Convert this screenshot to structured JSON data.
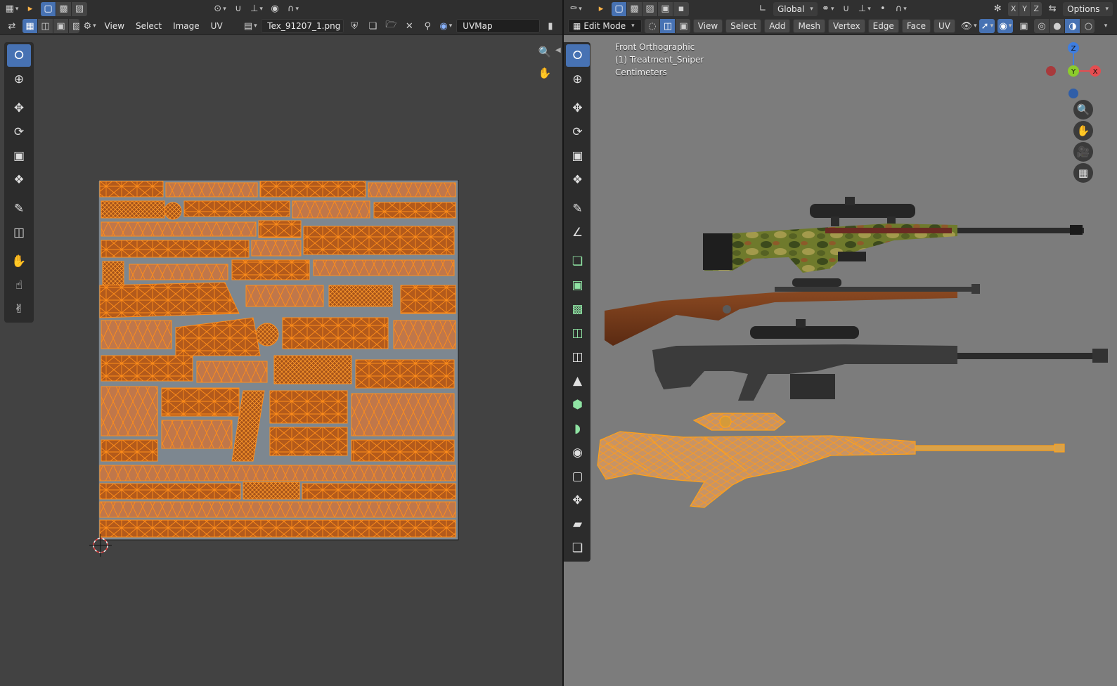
{
  "uv_editor": {
    "header": {
      "menus": [
        "View",
        "Select",
        "Image",
        "UV"
      ],
      "image_name": "Tex_91207_1.png",
      "uv_map": "UVMap"
    },
    "tools": [
      "select-box-icon",
      "cursor-icon",
      "move-icon",
      "rotate-icon",
      "scale-icon",
      "transform-icon",
      "annotate-icon",
      "rip-icon",
      "grab-icon",
      "relax-icon",
      "pinch-icon"
    ]
  },
  "viewport": {
    "header": {
      "orientation": "Global",
      "axes": [
        "X",
        "Y",
        "Z"
      ],
      "options": "Options",
      "mode": "Edit Mode",
      "menus": [
        "View",
        "Select",
        "Add",
        "Mesh",
        "Vertex",
        "Edge",
        "Face",
        "UV"
      ]
    },
    "overlay": {
      "view_name": "Front Orthographic",
      "object_name": "(1) Treatment_Sniper",
      "units": "Centimeters"
    },
    "gizmo": {
      "x": "X",
      "y": "Y",
      "z": "Z"
    },
    "colors": {
      "selection": "#ff8c1a",
      "active_tool": "#4772b3",
      "x_axis": "#e44d50",
      "y_axis": "#8ccc2c",
      "z_axis": "#3f7ee0"
    }
  }
}
